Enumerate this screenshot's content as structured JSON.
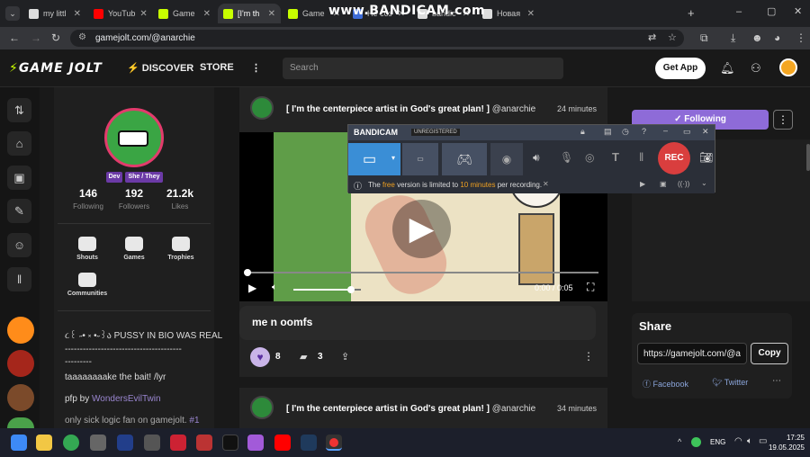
{
  "browser": {
    "tabs": [
      {
        "label": "my littl",
        "color": "#dddddd"
      },
      {
        "label": "YouTub",
        "color": "#ff0000"
      },
      {
        "label": "Game",
        "color": "#c8ff00"
      },
      {
        "label": "[I'm th",
        "color": "#c8ff00"
      },
      {
        "label": "Game",
        "color": "#c8ff00"
      },
      {
        "label": "Не соз",
        "color": "#3d6bd6"
      },
      {
        "label": "bandic",
        "color": "#dddddd"
      },
      {
        "label": "Новая",
        "color": "#dddddd"
      }
    ],
    "url": "gamejolt.com/@anarchie",
    "watermark": "www.BANDICAM.com"
  },
  "header": {
    "logo": "GAME JOLT",
    "discover": "DISCOVER",
    "store": "STORE",
    "search_placeholder": "Search",
    "get_app": "Get App"
  },
  "profile": {
    "badges": [
      "Dev",
      "She / They"
    ],
    "stats": [
      {
        "num": "146",
        "label": "Following"
      },
      {
        "num": "192",
        "label": "Followers"
      },
      {
        "num": "21.2k",
        "label": "Likes"
      }
    ],
    "nav": [
      "Shouts",
      "Games",
      "Trophies",
      "Communities"
    ],
    "bio": [
      "૮꒰ ˶• ༝ •˶꒱ა PUSSY IN BIO WAS REAL",
      "---------------------------------------",
      "---------",
      "taaaaaaaake the bait! /lyr",
      "pfp by",
      "WondersEvilTwin",
      "only sick logic fan on gamejolt.",
      "#1"
    ]
  },
  "post1": {
    "title": "[ I'm the centerpiece artist in God's great plan! ]",
    "user": "@anarchie",
    "time": "24 minutes",
    "video_time": "0:00 / 0:05",
    "progress": 0,
    "volume": 0.85,
    "caption": "me n oomfs",
    "likes": "8",
    "comments": "3"
  },
  "post2": {
    "title": "[ I'm the centerpiece artist in God's great plan! ]",
    "user": "@anarchie",
    "time": "34 minutes"
  },
  "right": {
    "following": "✓ Following",
    "share_title": "Share",
    "share_url": "https://gamejolt.com/@a",
    "copy": "Copy",
    "facebook": "Facebook",
    "twitter": "Twitter"
  },
  "bandicam": {
    "brand": "BANDICAM",
    "unregistered": "UNREGISTERED",
    "rec": "REC",
    "notice_pre": "The",
    "notice_free": "free",
    "notice_mid": "version is limited to",
    "notice_limit": "10 minutes",
    "notice_post": "per recording."
  },
  "taskbar": {
    "lang": "ENG",
    "time": "17:25",
    "date": "19.05.2025"
  }
}
